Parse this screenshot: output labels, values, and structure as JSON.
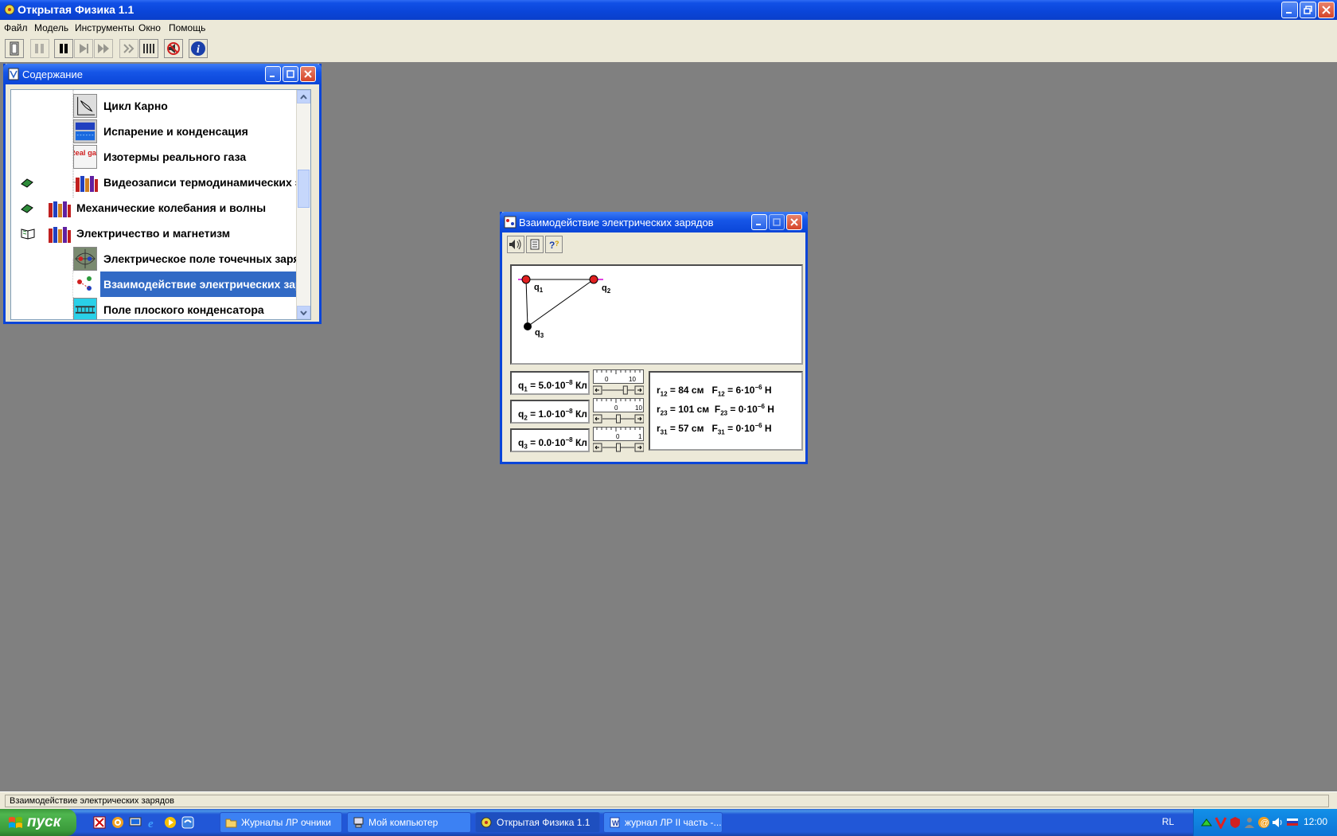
{
  "app": {
    "title": "Открытая Физика 1.1",
    "menu": [
      "Файл",
      "Модель",
      "Инструменты",
      "Окно",
      "Помощь"
    ]
  },
  "contents_window": {
    "title": "Содержание",
    "items": [
      {
        "label": "Цикл Карно",
        "icon": "carnot-cycle-icon"
      },
      {
        "label": "Испарение и конденсация",
        "icon": "evaporation-icon"
      },
      {
        "label": "Изотермы реального газа",
        "icon": "real-gas-icon",
        "icon_text": "Real gas"
      },
      {
        "label": "Видеозаписи термодинамических эк",
        "icon": "books-icon"
      },
      {
        "label": "Механические колебания и волны",
        "icon": "books-icon"
      },
      {
        "label": "Электричество и магнетизм",
        "icon": "books-icon"
      },
      {
        "label": "Электрическое поле точечных заряд",
        "icon": "point-charge-field-icon"
      },
      {
        "label": "Взаимодействие электрических зар",
        "icon": "charges-interaction-icon",
        "selected": true
      },
      {
        "label": "Поле плоского конденсатора",
        "icon": "capacitor-icon"
      }
    ]
  },
  "interaction_window": {
    "title": "Взаимодействие электрических зарядов",
    "scene_labels": {
      "q1": "q",
      "q1_sub": "1",
      "q2": "q",
      "q2_sub": "2",
      "q3": "q",
      "q3_sub": "3"
    },
    "charges": [
      {
        "name": "q",
        "sub": "1",
        "value": " = 5.0·10",
        "exp": "−8",
        "unit": " Кл",
        "slider_min": "0",
        "slider_max": "10",
        "level": 0.75
      },
      {
        "name": "q",
        "sub": "2",
        "value": " = 1.0·10",
        "exp": "−8",
        "unit": " Кл",
        "slider_min": "0",
        "slider_max": "10",
        "level": 0.5
      },
      {
        "name": "q",
        "sub": "3",
        "value": " = 0.0·10",
        "exp": "−8",
        "unit": " Кл",
        "slider_min": "0",
        "slider_max": "1",
        "level": 0.5
      }
    ],
    "results": [
      {
        "r": "r",
        "r_sub": "12",
        "r_val": " = 84 см",
        "f": "F",
        "f_sub": "12",
        "f_val": " = 6·10",
        "f_exp": "−6",
        "f_unit": " Н"
      },
      {
        "r": "r",
        "r_sub": "23",
        "r_val": " = 101 см",
        "f": "F",
        "f_sub": "23",
        "f_val": " = 0·10",
        "f_exp": "−6",
        "f_unit": " Н"
      },
      {
        "r": "r",
        "r_sub": "31",
        "r_val": " = 57 см",
        "f": "F",
        "f_sub": "31",
        "f_val": " = 0·10",
        "f_exp": "−6",
        "f_unit": " Н"
      }
    ]
  },
  "status_bar": {
    "text": "Взаимодействие электрических зарядов"
  },
  "taskbar": {
    "start_label": "пуск",
    "tasks": [
      {
        "label": "Журналы ЛР очники",
        "icon": "folder-icon"
      },
      {
        "label": "Мой компьютер",
        "icon": "computer-icon"
      },
      {
        "label": "Открытая Физика 1.1",
        "icon": "physics-app-icon",
        "active": true
      },
      {
        "label": "журнал ЛР II часть -...",
        "icon": "word-document-icon"
      }
    ],
    "language": "RL",
    "clock": "12:00"
  },
  "colors": {
    "title_blue": "#0a45d8",
    "selection": "#316ac5",
    "desktop_gray": "#808080"
  }
}
